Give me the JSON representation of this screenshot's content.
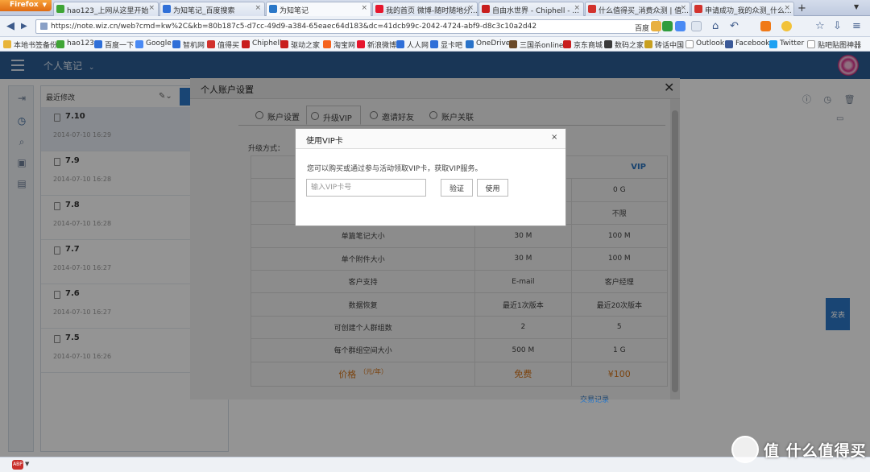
{
  "browser": {
    "app_button": "Firefox",
    "tabs": [
      {
        "title": "hao123_上网从这里开始",
        "favicon_color": "#3fa535"
      },
      {
        "title": "为知笔记_百度搜索",
        "favicon_color": "#2f6fd8"
      },
      {
        "title": "为知笔记",
        "favicon_color": "#2b78c8"
      },
      {
        "title": "我的首页 微博-随时随地分...",
        "favicon_color": "#e6162d"
      },
      {
        "title": "自由水世界 - Chiphell - ...",
        "favicon_color": "#c81e1e"
      },
      {
        "title": "什么值得买_消费众测 | 值...",
        "favicon_color": "#d2322d"
      },
      {
        "title": "申请成功_我的众测_什么...",
        "favicon_color": "#d2322d"
      }
    ],
    "new_tab_symbol": "+",
    "url": "https://note.wiz.cn/web?cmd=kw%2C&kb=80b187c5-d7cc-49d9-a384-65eaec64d183&dc=41dcb99c-2042-4724-abf9-d8c3c10a2d42",
    "search_engine": "百度",
    "bookmarks": [
      {
        "label": "本地书签备份",
        "color": "#e8b53a"
      },
      {
        "label": "hao123",
        "color": "#3fa535"
      },
      {
        "label": "百度一下",
        "color": "#2f6fd8"
      },
      {
        "label": "Google",
        "color": "#4a8af4"
      },
      {
        "label": "智机网",
        "color": "#2f6fd8"
      },
      {
        "label": "值得买",
        "color": "#d2322d"
      },
      {
        "label": "Chiphell",
        "color": "#c81e1e"
      },
      {
        "label": "驱动之家",
        "color": "#c81e1e"
      },
      {
        "label": "淘宝网",
        "color": "#f5631e"
      },
      {
        "label": "新浪微博",
        "color": "#e6162d"
      },
      {
        "label": "人人网",
        "color": "#2f6fd8"
      },
      {
        "label": "显卡吧",
        "color": "#2f6fd8"
      },
      {
        "label": "OneDrive",
        "color": "#2a73c9"
      },
      {
        "label": "三国杀online",
        "color": "#6b4b2a"
      },
      {
        "label": "京东商城",
        "color": "#c81e1e"
      },
      {
        "label": "数码之家",
        "color": "#3a3a3a"
      },
      {
        "label": "砖话中国",
        "color": "#c8a020"
      },
      {
        "label": "Outlook",
        "color": "#ffffff"
      },
      {
        "label": "Facebook",
        "color": "#3b5998"
      },
      {
        "label": "Twitter",
        "color": "#1da1f2"
      },
      {
        "label": "贴吧贴图神器",
        "color": "#ffffff"
      }
    ]
  },
  "app": {
    "notebook_title": "个人笔记",
    "list_header": "最近修改",
    "notes": [
      {
        "title": "7.10",
        "date": "2014-07-10 16:29"
      },
      {
        "title": "7.9",
        "date": "2014-07-10 16:28"
      },
      {
        "title": "7.8",
        "date": "2014-07-10 16:28"
      },
      {
        "title": "7.7",
        "date": "2014-07-10 16:27"
      },
      {
        "title": "7.6",
        "date": "2014-07-10 16:27"
      },
      {
        "title": "7.5",
        "date": "2014-07-10 16:26"
      }
    ],
    "send_label": "发表"
  },
  "account_dialog": {
    "title": "个人账户设置",
    "tabs": [
      "账户设置",
      "升级VIP",
      "邀请好友",
      "账户关联"
    ],
    "active_tab": "升级VIP",
    "upgrade_method_label": "升级方式：",
    "table": {
      "header_vip": "VIP",
      "rows": [
        {
          "feature": "",
          "free": "",
          "vip": "0 G"
        },
        {
          "feature": "",
          "free": "",
          "vip": "不限"
        },
        {
          "feature": "单篇笔记大小",
          "free": "30 M",
          "vip": "100 M"
        },
        {
          "feature": "单个附件大小",
          "free": "30 M",
          "vip": "100 M"
        },
        {
          "feature": "客户支持",
          "free": "E-mail",
          "vip": "客户经理"
        },
        {
          "feature": "数据恢复",
          "free": "最近1次版本",
          "vip": "最近20次版本"
        },
        {
          "feature": "可创建个人群组数",
          "free": "2",
          "vip": "5"
        },
        {
          "feature": "每个群组空间大小",
          "free": "500 M",
          "vip": "1 G"
        }
      ],
      "price_label": "价格",
      "price_unit": "（元/年）",
      "price_free": "免费",
      "price_vip": "¥100"
    },
    "records_link": "交易记录"
  },
  "vip_dialog": {
    "title": "使用VIP卡",
    "description": "您可以购买或通过参与活动领取VIP卡，获取VIP服务。",
    "input_placeholder": "输入VIP卡号",
    "verify_label": "验证",
    "use_label": "使用",
    "close_symbol": "×"
  },
  "watermark": "值 什么值得买",
  "colors": {
    "app_header": "#2b5d95",
    "accent": "#2b78c8",
    "price": "#e07a1a"
  }
}
